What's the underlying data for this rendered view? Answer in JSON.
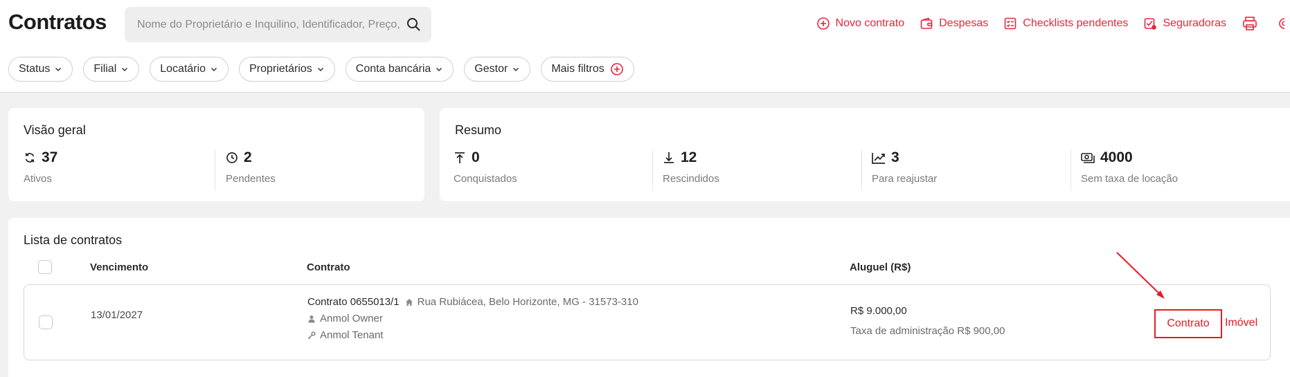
{
  "header": {
    "title": "Contratos",
    "search_placeholder": "Nome do Proprietário e Inquilino, Identificador, Preço, E",
    "actions": [
      {
        "label": "Novo contrato",
        "icon": "plus-circle-icon"
      },
      {
        "label": "Despesas",
        "icon": "wallet-icon"
      },
      {
        "label": "Checklists pendentes",
        "icon": "checklist-icon"
      },
      {
        "label": "Seguradoras",
        "icon": "shield-check-icon"
      }
    ],
    "extra_icons": [
      "printer-icon",
      "settings-icon"
    ]
  },
  "filters": [
    {
      "label": "Status"
    },
    {
      "label": "Filial"
    },
    {
      "label": "Locatário"
    },
    {
      "label": "Proprietários"
    },
    {
      "label": "Conta bancária"
    },
    {
      "label": "Gestor"
    },
    {
      "label": "Mais filtros"
    }
  ],
  "overview": {
    "title": "Visão geral",
    "stats": [
      {
        "value": "37",
        "label": "Ativos",
        "icon": "refresh-icon"
      },
      {
        "value": "2",
        "label": "Pendentes",
        "icon": "clock-icon"
      }
    ]
  },
  "summary": {
    "title": "Resumo",
    "stats": [
      {
        "value": "0",
        "label": "Conquistados",
        "icon": "arrow-up-bar-icon"
      },
      {
        "value": "12",
        "label": "Rescindidos",
        "icon": "arrow-down-bar-icon"
      },
      {
        "value": "3",
        "label": "Para reajustar",
        "icon": "trending-up-icon"
      },
      {
        "value": "4000",
        "label": "Sem taxa de locação",
        "icon": "cash-icon"
      }
    ]
  },
  "contracts_list": {
    "title": "Lista de contratos",
    "columns": [
      "Vencimento",
      "Contrato",
      "Aluguel (R$)"
    ],
    "rows": [
      {
        "due_date": "13/01/2027",
        "contract_id": "Contrato 0655013/1",
        "address": "Rua Rubiácea, Belo Horizonte, MG - 31573-310",
        "owner": "Anmol Owner",
        "tenant": "Anmol Tenant",
        "rent": "R$ 9.000,00",
        "admin_fee": "Taxa de administração R$ 900,00",
        "btn_contract": "Contrato",
        "btn_property": "Imóvel"
      }
    ]
  },
  "colors": {
    "accent": "#e8243c",
    "highlight_border": "#e51b24",
    "background": "#f1f1f1"
  }
}
